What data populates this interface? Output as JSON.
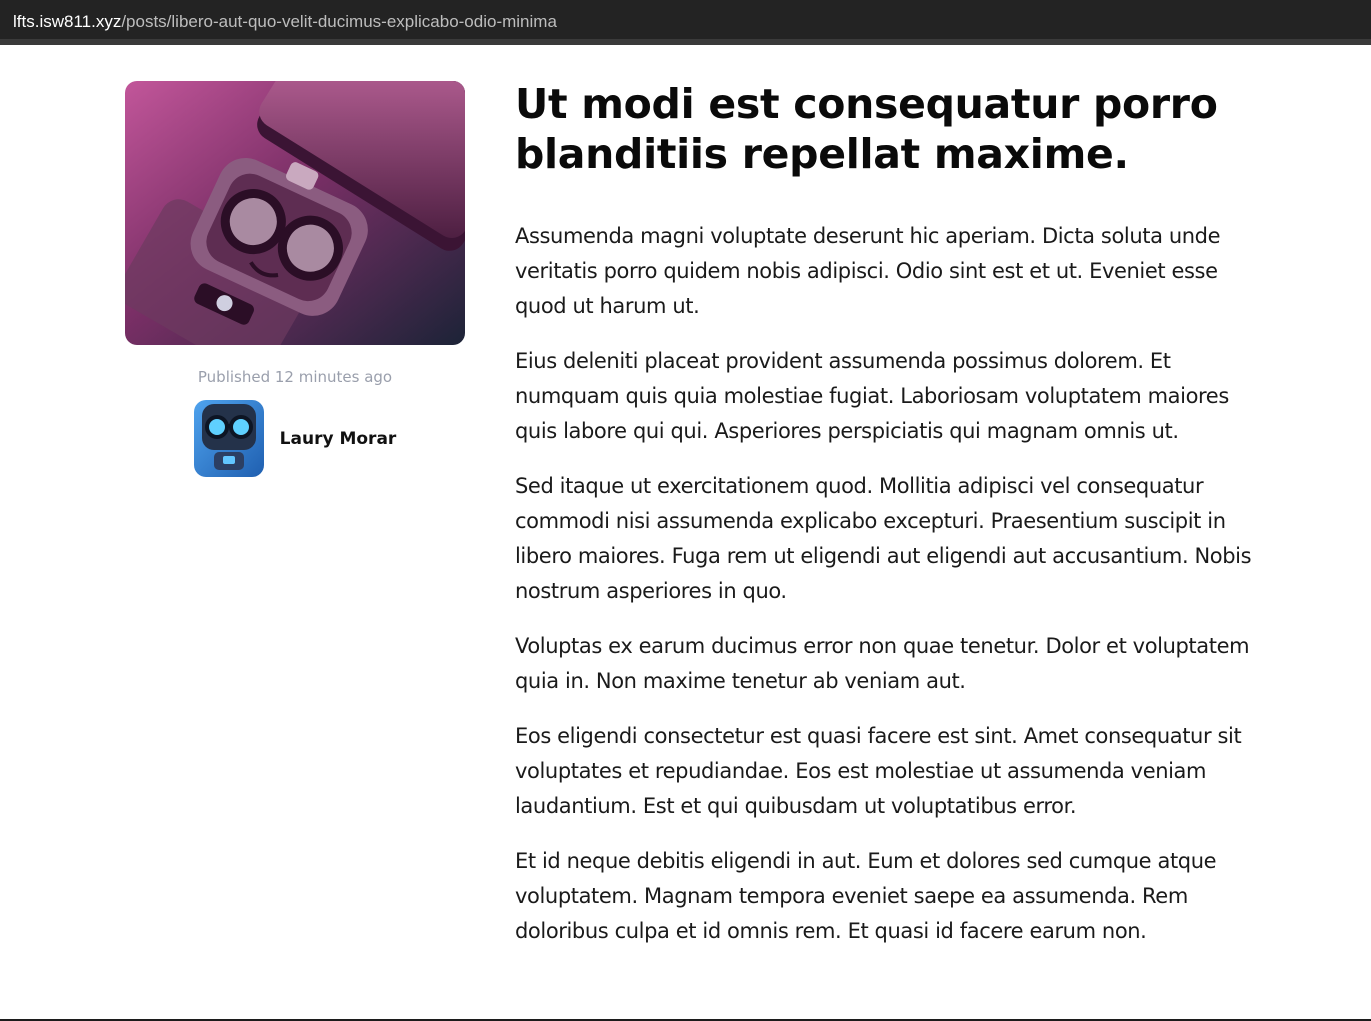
{
  "browser": {
    "url_host": "lfts.isw811.xyz",
    "url_path": "/posts/libero-aut-quo-velit-ducimus-explicabo-odio-minima"
  },
  "post": {
    "published": "Published 12 minutes ago",
    "author_name": "Laury Morar",
    "title": "Ut modi est consequatur porro blanditiis repellat maxime.",
    "paragraphs": [
      "Assumenda magni voluptate deserunt hic aperiam. Dicta soluta unde veritatis porro quidem nobis adipisci. Odio sint est et ut. Eveniet esse quod ut harum ut.",
      "Eius deleniti placeat provident assumenda possimus dolorem. Et numquam quis quia molestiae fugiat. Laboriosam voluptatem maiores quis labore qui qui. Asperiores perspiciatis qui magnam omnis ut.",
      "Sed itaque ut exercitationem quod. Mollitia adipisci vel consequatur commodi nisi assumenda explicabo excepturi. Praesentium suscipit in libero maiores. Fuga rem ut eligendi aut eligendi aut accusantium. Nobis nostrum asperiores in quo.",
      "Voluptas ex earum ducimus error non quae tenetur. Dolor et voluptatem quia in. Non maxime tenetur ab veniam aut.",
      "Eos eligendi consectetur est quasi facere est sint. Amet consequatur sit voluptates et repudiandae. Eos est molestiae ut assumenda veniam laudantium. Est et qui quibusdam ut voluptatibus error.",
      "Et id neque debitis eligendi in aut. Eum et dolores sed cumque atque voluptatem. Magnam tempora eveniet saepe ea assumenda. Rem doloribus culpa et id omnis rem. Et quasi id facere earum non."
    ]
  },
  "colors": {
    "urlbar_bg": "#232323",
    "cover_top": "#c2569a",
    "cover_bottom": "#1c2337",
    "avatar_bg": "#2e7fd6",
    "meta_text": "#9a9fac"
  },
  "icons": {
    "cover": "robot-illustration",
    "avatar": "robot-avatar-icon"
  }
}
